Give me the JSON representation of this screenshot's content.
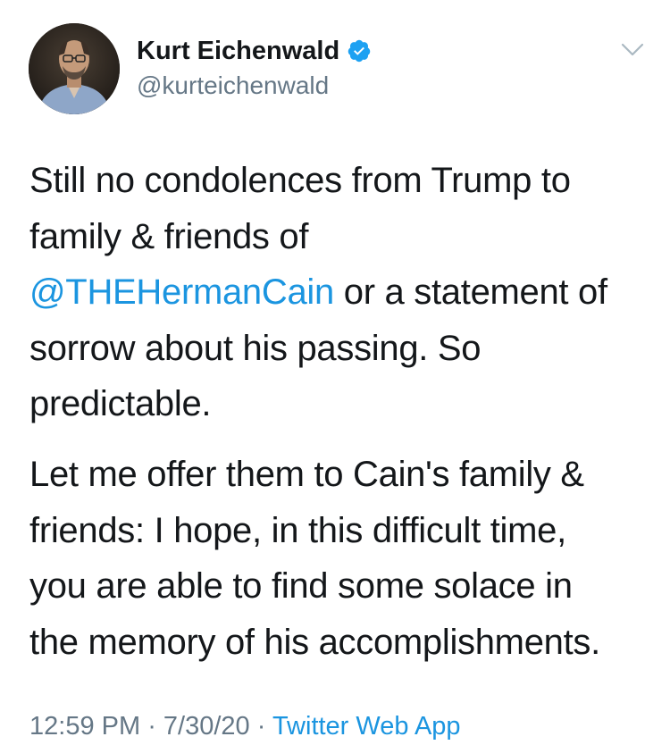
{
  "author": {
    "display_name": "Kurt Eichenwald",
    "handle": "@kurteichenwald",
    "verified": true
  },
  "icons": {
    "verified_badge": "verified-badge-icon",
    "more_menu": "chevron-down-icon"
  },
  "tweet": {
    "paragraph1": {
      "line1": "Still no condolences from Trump to",
      "line2": "family & friends of",
      "mention": "@THEHermanCain",
      "line3_rest": " or a statement of",
      "line4": "sorrow about his passing. So",
      "line5": "predictable."
    },
    "paragraph2": {
      "line1": "Let me offer them to Cain's family &",
      "line2": "friends: I hope, in this difficult time,",
      "line3": "you are able to find some solace in",
      "line4": "the memory of his accomplishments."
    }
  },
  "footer": {
    "time": "12:59 PM",
    "separator1": " · ",
    "date": "7/30/20",
    "separator2": " · ",
    "source": "Twitter Web App"
  },
  "colors": {
    "link": "#1b95e0",
    "secondary_text": "#657786",
    "primary_text": "#14171a",
    "verified_blue": "#1da1f2"
  }
}
